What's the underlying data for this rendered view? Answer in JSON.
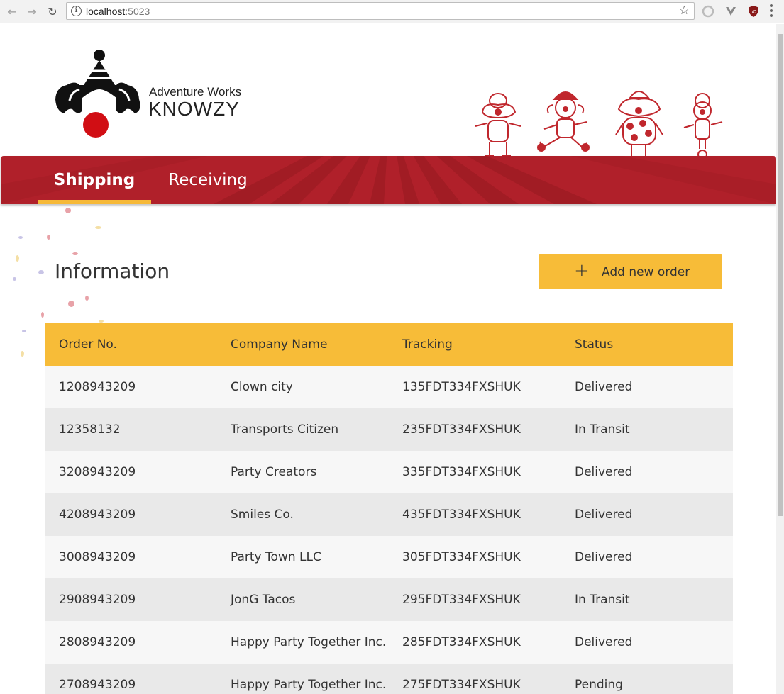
{
  "browser": {
    "url_host": "localhost",
    "url_port": ":5023"
  },
  "brand": {
    "line1": "Adventure Works",
    "line2": "KNOWZY"
  },
  "nav": {
    "tabs": [
      {
        "label": "Shipping",
        "active": true
      },
      {
        "label": "Receiving",
        "active": false
      }
    ]
  },
  "main": {
    "title": "Information",
    "add_button_label": "Add new order"
  },
  "table": {
    "headers": [
      "Order No.",
      "Company Name",
      "Tracking",
      "Status"
    ],
    "rows": [
      [
        "1208943209",
        "Clown city",
        "135FDT334FXSHUK",
        "Delivered"
      ],
      [
        "12358132",
        "Transports Citizen",
        "235FDT334FXSHUK",
        "In Transit"
      ],
      [
        "3208943209",
        "Party Creators",
        "335FDT334FXSHUK",
        "Delivered"
      ],
      [
        "4208943209",
        "Smiles Co.",
        "435FDT334FXSHUK",
        "Delivered"
      ],
      [
        "3008943209",
        "Party Town LLC",
        "305FDT334FXSHUK",
        "Delivered"
      ],
      [
        "2908943209",
        "JonG Tacos",
        "295FDT334FXSHUK",
        "In Transit"
      ],
      [
        "2808943209",
        "Happy Party Together Inc.",
        "285FDT334FXSHUK",
        "Delivered"
      ],
      [
        "2708943209",
        "Happy Party Together Inc.",
        "275FDT334FXSHUK",
        "Pending"
      ]
    ]
  },
  "colors": {
    "accent": "#f7bc38",
    "navbar": "#b0202a",
    "row_odd": "#f7f7f7",
    "row_even": "#e9e9e9"
  }
}
